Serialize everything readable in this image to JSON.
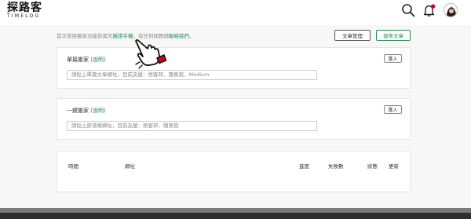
{
  "brand": {
    "name_cn": "探路客",
    "name_en": "TIMELOG"
  },
  "header": {
    "icons": [
      "search-icon",
      "bell-icon",
      "avatar"
    ],
    "notification_color": "#d0021b"
  },
  "notice": {
    "prefix": "首次使用搬家功能前需先",
    "link1": "驗證手機",
    "middle": "，有任何問題請",
    "link2": "聯絡我們",
    "suffix": "。"
  },
  "toolbar": {
    "manage_label": "文章管理",
    "publish_label": "發佈文章"
  },
  "single_move": {
    "title": "單篇搬家",
    "help": "(說明)",
    "import_label": "匯入",
    "placeholder": "請貼上單篇文章網址，目前支援：痞客邦、隨意窩、Medium"
  },
  "bulk_move": {
    "title": "一鍵搬家",
    "help": "(說明)",
    "import_label": "匯入",
    "placeholder": "請貼上部落格網址，目前支援：痞客邦、隨意窩"
  },
  "history_table": {
    "columns": [
      "時間",
      "網址",
      "進度",
      "失敗數",
      "狀態",
      "更新"
    ]
  },
  "colors": {
    "accent": "#2e8b57",
    "alert": "#d0021b"
  }
}
